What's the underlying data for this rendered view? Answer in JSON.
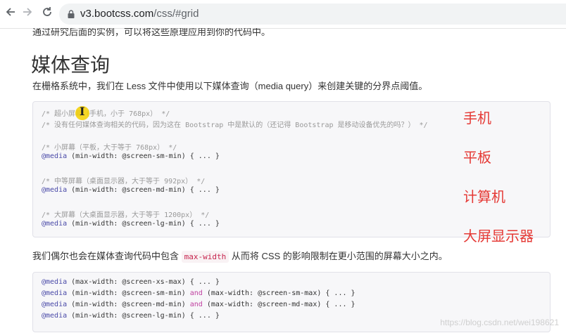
{
  "browser": {
    "back_icon": "arrow-left-icon",
    "forward_icon": "arrow-right-icon",
    "reload_icon": "reload-icon",
    "lock_icon": "lock-icon",
    "url_host": "v3.bootcss.com",
    "url_path": "/css/#grid"
  },
  "page": {
    "intro": "通过研究后面的实例，可以将这些原理应用到你的代码中。",
    "heading": "媒体查询",
    "para1": "在栅格系统中，我们在 Less 文件中使用以下媒体查询（media query）来创建关键的分界点阈值。",
    "para2_before": "我们偶尔也会在媒体查询代码中包含 ",
    "para2_code": "max-width",
    "para2_after": " 从而将 CSS 的影响限制在更小范围的屏幕大小之内。"
  },
  "code1": {
    "c1": "/* 超小屏幕（手机，小于 768px） */",
    "c2": "/* 没有任何媒体查询相关的代码，因为这在 Bootstrap 中是默认的（还记得 Bootstrap 是移动设备优先的吗？） */",
    "c3": "/* 小屏幕（平板，大于等于 768px） */",
    "m3": "(min-width: @screen-sm-min) { ... }",
    "c4": "/* 中等屏幕（桌面显示器，大于等于 992px） */",
    "m4": "(min-width: @screen-md-min) { ... }",
    "c5": "/* 大屏幕（大桌面显示器，大于等于 1200px） */",
    "m5": "(min-width: @screen-lg-min) { ... }",
    "media_kw": "@media"
  },
  "code2": {
    "media_kw": "@media",
    "and_kw": "and",
    "l1": "(max-width: @screen-xs-max) { ... }",
    "l2a": "(min-width: @screen-sm-min) ",
    "l2b": " (max-width: @screen-sm-max) { ... }",
    "l3a": "(min-width: @screen-md-min) ",
    "l3b": " (max-width: @screen-md-max) { ... }",
    "l4": "(min-width: @screen-lg-min) { ... }"
  },
  "annotations": {
    "phone": "手机",
    "tablet": "平板",
    "computer": "计算机",
    "large_display": "大屏显示器"
  },
  "watermark": "https://blog.csdn.net/wei198621",
  "colors": {
    "annotation": "#e53935",
    "inline_code": "#c7254e",
    "cursor_highlight": "#f5d000"
  }
}
